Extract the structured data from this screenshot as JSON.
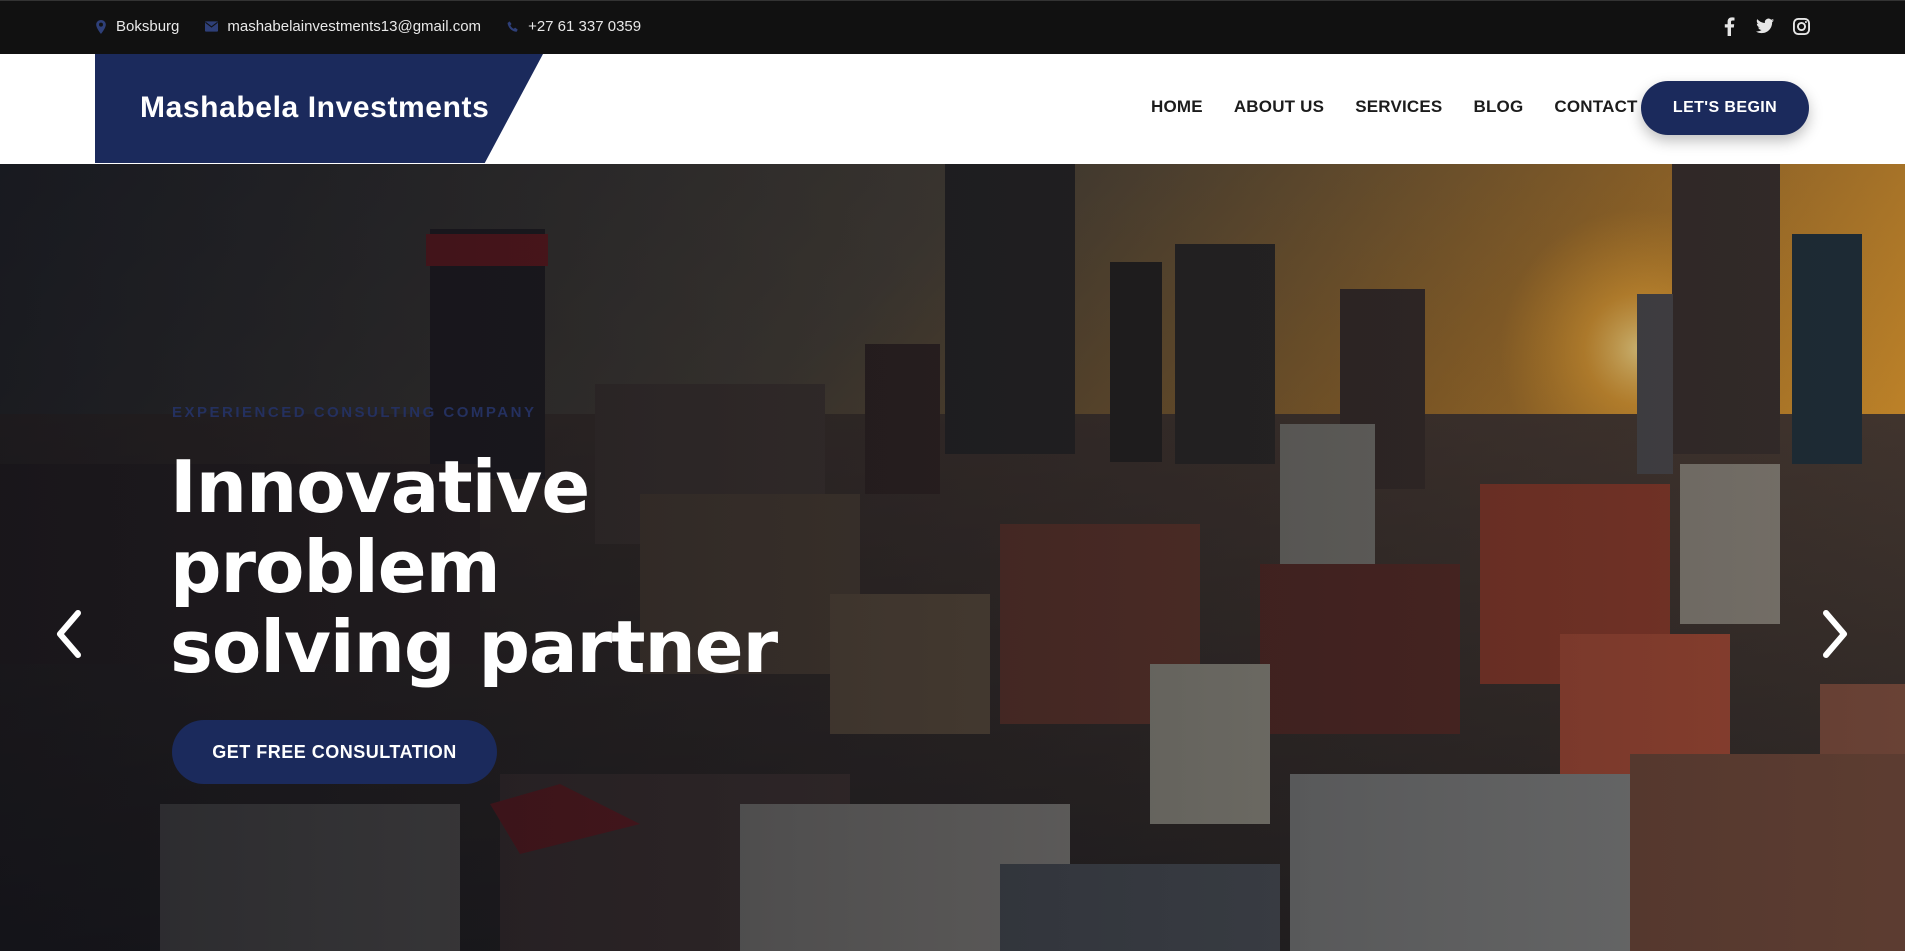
{
  "topbar": {
    "location": "Boksburg",
    "email": "mashabelainvestments13@gmail.com",
    "phone": "+27 61 337 0359",
    "social": [
      "facebook-icon",
      "twitter-icon",
      "instagram-icon"
    ]
  },
  "brand": {
    "name": "Mashabela Investments"
  },
  "nav": {
    "items": [
      "HOME",
      "ABOUT US",
      "SERVICES",
      "BLOG",
      "CONTACT"
    ],
    "cta": "LET'S BEGIN"
  },
  "hero": {
    "eyebrow": "EXPERIENCED CONSULTING COMPANY",
    "headline": [
      "Innovative",
      "problem",
      "solving partner"
    ],
    "button": "GET FREE CONSULTATION"
  },
  "colors": {
    "brand": "#1b2a5c",
    "topbar": "#111111",
    "nav_bg": "#ffffff"
  }
}
